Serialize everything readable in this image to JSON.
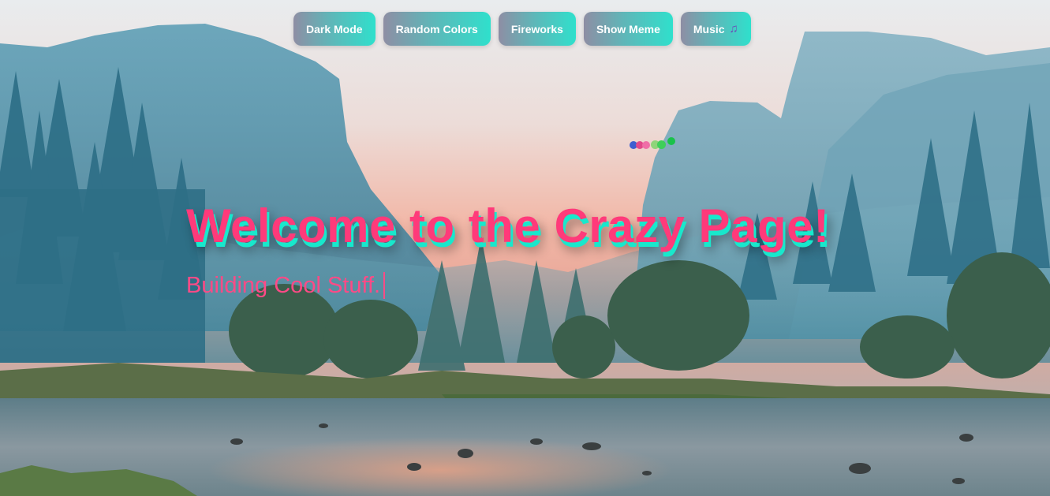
{
  "toolbar": {
    "buttons": [
      {
        "label": "Dark Mode"
      },
      {
        "label": "Random Colors"
      },
      {
        "label": "Fireworks"
      },
      {
        "label": "Show Meme"
      },
      {
        "label": "Music",
        "icon": "music-note-icon"
      }
    ]
  },
  "hero": {
    "title": "Welcome to the Crazy Page!",
    "subtitle": "Building Cool Stuff."
  },
  "colors": {
    "title_pink": "#ff3a7a",
    "title_shadow_teal": "#18e8cc",
    "button_start": "#8e8ea4",
    "button_end": "#2fe0cc"
  }
}
